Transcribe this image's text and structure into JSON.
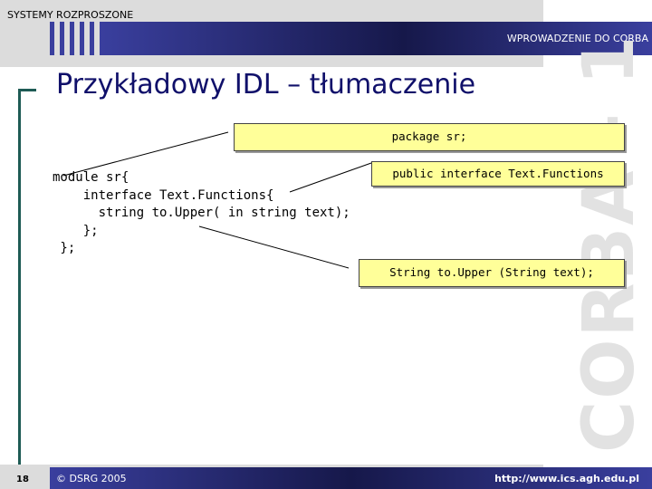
{
  "header": {
    "course": "SYSTEMY ROZPROSZONE",
    "chapter": "WPROWADZENIE DO CORBA",
    "watermark": "CORBA - 1"
  },
  "title": "Przykładowy IDL – tłumaczenie",
  "code": "module sr{\n    interface Text.Functions{\n      string to.Upper( in string text);\n    };\n };",
  "callouts": [
    "package sr;",
    "public interface Text.Functions",
    "String to.Upper (String text);"
  ],
  "footer": {
    "page": "18",
    "copyright": "© DSRG 2005",
    "url": "http://www.ics.agh.edu.pl"
  },
  "colors": {
    "bar": "#16184a",
    "callout": "#ffff99",
    "title": "#10106a"
  }
}
